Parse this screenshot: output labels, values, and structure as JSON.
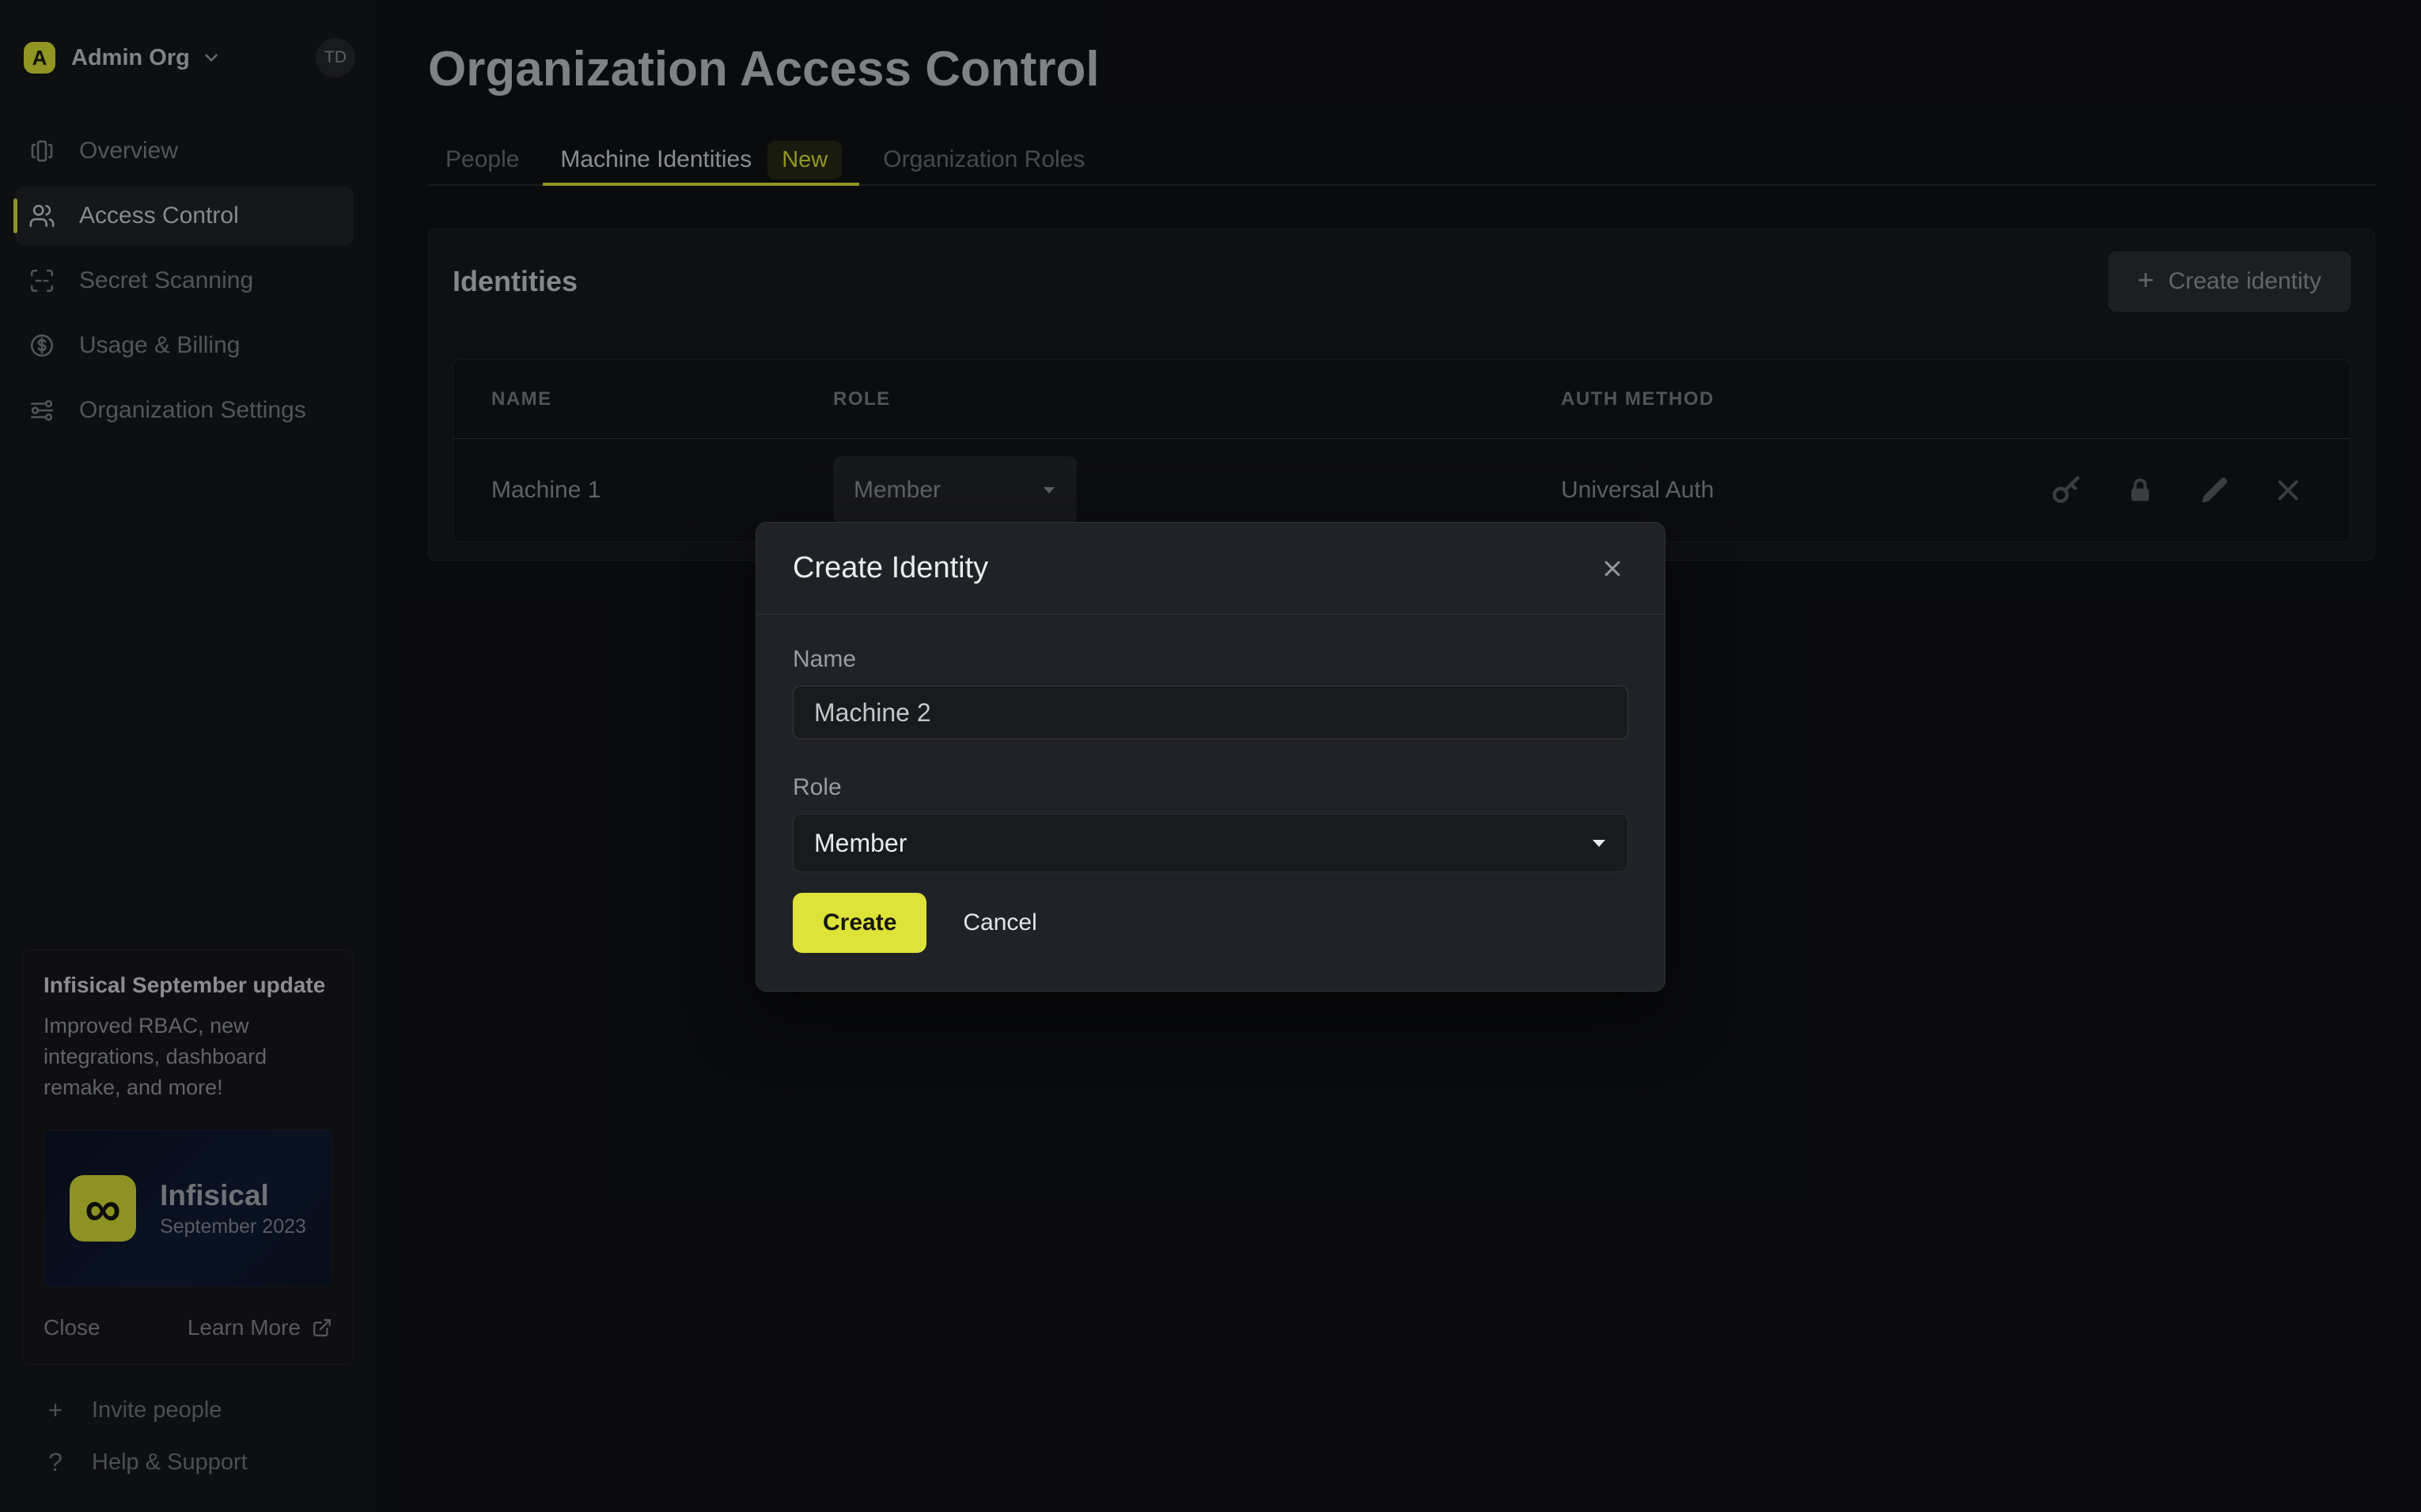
{
  "brand": {
    "accent_color": "#dce333"
  },
  "sidebar": {
    "org": {
      "initial": "A",
      "name": "Admin Org",
      "user_initials": "TD"
    },
    "items": [
      {
        "label": "Overview"
      },
      {
        "label": "Access Control"
      },
      {
        "label": "Secret Scanning"
      },
      {
        "label": "Usage & Billing"
      },
      {
        "label": "Organization Settings"
      }
    ],
    "update_card": {
      "title": "Infisical September update",
      "body": "Improved RBAC, new integrations, dashboard remake, and more!",
      "banner_logo_text": "Infisical",
      "banner_logo_subtext": "September 2023",
      "banner_logo_glyph": "∞",
      "close_label": "Close",
      "learn_more_label": "Learn More"
    },
    "footer": {
      "invite_label": "Invite people",
      "help_label": "Help & Support",
      "invite_glyph": "+",
      "help_glyph": "?"
    }
  },
  "header": {
    "title": "Organization Access Control"
  },
  "tabs": [
    {
      "label": "People"
    },
    {
      "label": "Machine Identities",
      "badge": "New"
    },
    {
      "label": "Organization Roles"
    }
  ],
  "identities_panel": {
    "title": "Identities",
    "create_button_label": "Create identity",
    "create_button_plus": "+",
    "table": {
      "columns": [
        "NAME",
        "ROLE",
        "AUTH METHOD"
      ],
      "rows": [
        {
          "name": "Machine 1",
          "role": "Member",
          "auth_method": "Universal Auth"
        }
      ]
    }
  },
  "modal": {
    "title": "Create Identity",
    "name_label": "Name",
    "name_value": "Machine 2",
    "role_label": "Role",
    "role_value": "Member",
    "create_label": "Create",
    "cancel_label": "Cancel"
  }
}
